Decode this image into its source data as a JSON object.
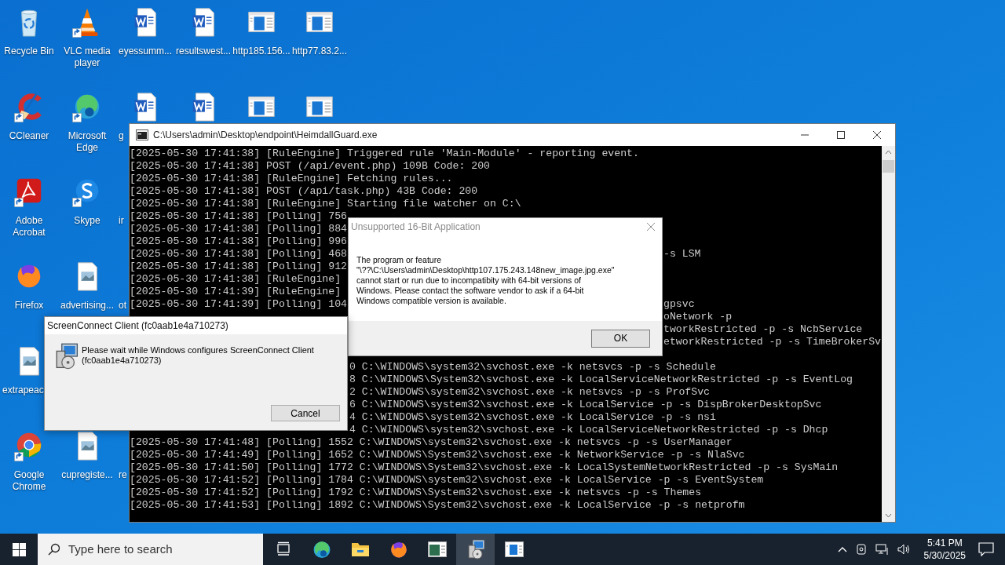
{
  "desktop": {
    "icon_rows": [
      [
        {
          "label": "Recycle Bin",
          "kind": "recycle"
        },
        {
          "label": "VLC media player",
          "kind": "vlc",
          "shortcut": true
        },
        {
          "label": "eyessumm...",
          "kind": "word"
        },
        {
          "label": "resultswest...",
          "kind": "word"
        },
        {
          "label": "http185.156...",
          "kind": "appwin"
        },
        {
          "label": "http77.83.2...",
          "kind": "appwin"
        }
      ],
      [
        {
          "label": "CCleaner",
          "kind": "ccleaner",
          "shortcut": true
        },
        {
          "label": "Microsoft Edge",
          "kind": "edge",
          "shortcut": true
        },
        {
          "label": "g",
          "kind": "word",
          "cut": true
        },
        {
          "kind": "word"
        },
        {
          "kind": "appwin"
        },
        {
          "kind": "appwin"
        }
      ],
      [
        {
          "label": "Adobe Acrobat",
          "kind": "acrobat",
          "shortcut": true
        },
        {
          "label": "Skype",
          "kind": "skype",
          "shortcut": true
        },
        {
          "label": "ir",
          "kind": "hidden",
          "cut": true
        }
      ],
      [
        {
          "label": "Firefox",
          "kind": "firefox"
        },
        {
          "label": "advertising...",
          "kind": "image"
        },
        {
          "label": "ot",
          "kind": "hidden",
          "cut": true
        }
      ],
      [
        {
          "label": "extrapeac",
          "kind": "image",
          "cut": true
        }
      ],
      [
        {
          "label": "Google Chrome",
          "kind": "chrome",
          "shortcut": true
        },
        {
          "label": "cupregiste...",
          "kind": "image"
        },
        {
          "label": "re",
          "kind": "hidden",
          "cut": true
        }
      ]
    ]
  },
  "console": {
    "title": "C:\\Users\\admin\\Desktop\\endpoint\\HeimdallGuard.exe",
    "lines": [
      {
        "left": "[2025-05-30 17:41:38] [RuleEngine] Triggered rule 'Main-Module' - reporting event."
      },
      {
        "left": "[2025-05-30 17:41:38] POST (/api/event.php) 109B Code: 200"
      },
      {
        "left": "[2025-05-30 17:41:38] [RuleEngine] Fetching rules..."
      },
      {
        "left": "[2025-05-30 17:41:38] POST (/api/task.php) 43B Code: 200"
      },
      {
        "left": "[2025-05-30 17:41:38] [RuleEngine] Starting file watcher on C:\\"
      },
      {
        "left": "[2025-05-30 17:41:38] [Polling] 756"
      },
      {
        "left": "[2025-05-30 17:41:38] [Polling] 884"
      },
      {
        "left": "[2025-05-30 17:41:38] [Polling] 996"
      },
      {
        "left": "[2025-05-30 17:41:38] [Polling] 468",
        "right": "-s LSM"
      },
      {
        "left": "[2025-05-30 17:41:38] [Polling] 912"
      },
      {
        "left": "[2025-05-30 17:41:38] [RuleEngine]"
      },
      {
        "left": "[2025-05-30 17:41:39] [RuleEngine]"
      },
      {
        "left": "[2025-05-30 17:41:39] [Polling] 104",
        "right": "gpsvc"
      },
      {
        "right": "oNetwork -p"
      },
      {
        "right": "tworkRestricted -p -s NcbService"
      },
      {
        "right": "etworkRestricted -p -s TimeBrokerSv"
      }
    ],
    "lines_below": [
      {
        "tail": "0 C:\\WINDOWS\\system32\\svchost.exe -k netsvcs -p -s Schedule"
      },
      {
        "tail": "8 C:\\WINDOWS\\System32\\svchost.exe -k LocalServiceNetworkRestricted -p -s EventLog"
      },
      {
        "tail": "2 C:\\WINDOWS\\system32\\svchost.exe -k netsvcs -p -s ProfSvc"
      },
      {
        "tail": "6 C:\\WINDOWS\\system32\\svchost.exe -k LocalService -p -s DispBrokerDesktopSvc"
      },
      {
        "tail": "4 C:\\WINDOWS\\system32\\svchost.exe -k LocalService -p -s nsi"
      },
      {
        "tail": "4 C:\\WINDOWS\\system32\\svchost.exe -k LocalServiceNetworkRestricted -p -s Dhcp"
      },
      {
        "left": "[2025-05-30 17:41:48] [Polling] 1552 C:\\WINDOWS\\system32\\svchost.exe -k netsvcs -p -s UserManager"
      },
      {
        "left": "[2025-05-30 17:41:49] [Polling] 1652 C:\\WINDOWS\\System32\\svchost.exe -k NetworkService -p -s NlaSvc"
      },
      {
        "left": "[2025-05-30 17:41:50] [Polling] 1772 C:\\WINDOWS\\System32\\svchost.exe -k LocalSystemNetworkRestricted -p -s SysMain"
      },
      {
        "left": "[2025-05-30 17:41:52] [Polling] 1784 C:\\WINDOWS\\system32\\svchost.exe -k LocalService -p -s EventSystem"
      },
      {
        "left": "[2025-05-30 17:41:52] [Polling] 1792 C:\\WINDOWS\\System32\\svchost.exe -k netsvcs -p -s Themes"
      },
      {
        "left": "[2025-05-30 17:41:53] [Polling] 1892 C:\\WINDOWS\\System32\\svchost.exe -k LocalService -p -s netprofm"
      }
    ]
  },
  "alert": {
    "title": "Unsupported 16-Bit Application",
    "active": false,
    "message": "The program or feature\n\"\\??\\C:\\Users\\admin\\Desktop\\http107.175.243.148new_image.jpg.exe\"\ncannot start or run due to incompatibity with 64-bit versions of\nWindows. Please contact the software vendor to ask if a 64-bit\nWindows compatible version is available.",
    "button": "OK"
  },
  "installer": {
    "title": "ScreenConnect Client (fc0aab1e4a710273)",
    "active": true,
    "message": "Please wait while Windows configures ScreenConnect Client\n(fc0aab1e4a710273)",
    "button": "Cancel"
  },
  "taskbar": {
    "search_placeholder": "Type here to search",
    "apps": [
      {
        "kind": "taskview",
        "selected": false
      },
      {
        "kind": "edge",
        "selected": false
      },
      {
        "kind": "explorer",
        "selected": false
      },
      {
        "kind": "firefox",
        "selected": false
      },
      {
        "kind": "console",
        "selected": false
      },
      {
        "kind": "installer",
        "selected": true
      },
      {
        "kind": "appwin",
        "selected": false
      }
    ],
    "time": "5:41 PM",
    "date": "5/30/2025"
  }
}
